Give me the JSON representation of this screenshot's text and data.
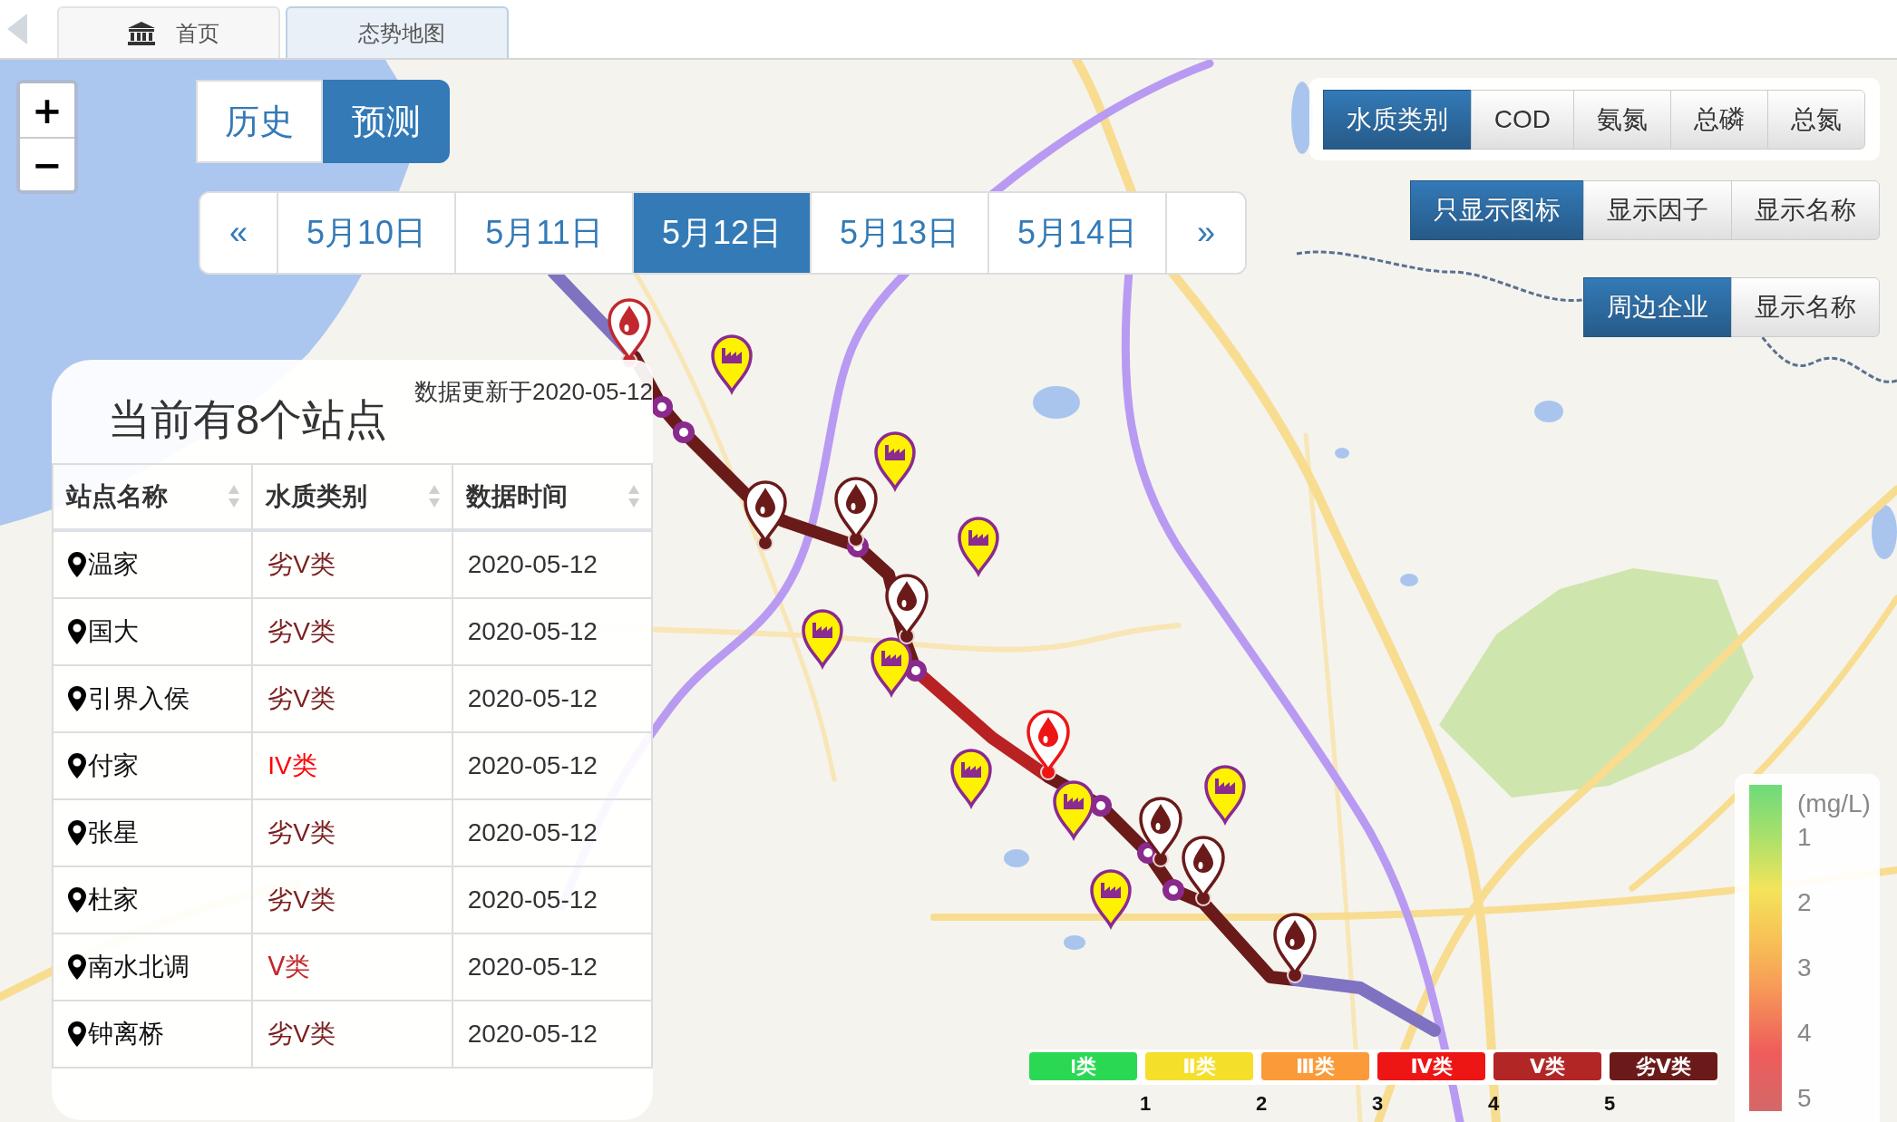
{
  "tabs": [
    {
      "kind": "home",
      "label": "首页",
      "selected": false
    },
    {
      "kind": "page",
      "label": "态势地图",
      "selected": true
    }
  ],
  "zoom": {
    "zoom_in": "+",
    "zoom_out": "−"
  },
  "mode_toggle": [
    {
      "label": "历史",
      "selected": false
    },
    {
      "label": "预测",
      "selected": true
    }
  ],
  "date_pager": {
    "prev": "«",
    "dates": [
      {
        "label": "5月10日",
        "selected": false
      },
      {
        "label": "5月11日",
        "selected": false
      },
      {
        "label": "5月12日",
        "selected": true
      },
      {
        "label": "5月13日",
        "selected": false
      },
      {
        "label": "5月14日",
        "selected": false
      }
    ],
    "next": "»"
  },
  "factor_buttons": [
    {
      "label": "水质类别",
      "selected": true
    },
    {
      "label": "COD",
      "selected": false
    },
    {
      "label": "氨氮",
      "selected": false
    },
    {
      "label": "总磷",
      "selected": false
    },
    {
      "label": "总氮",
      "selected": false
    }
  ],
  "display_buttons": [
    {
      "label": "只显示图标",
      "selected": true
    },
    {
      "label": "显示因子",
      "selected": false
    },
    {
      "label": "显示名称",
      "selected": false
    }
  ],
  "enterprise_buttons": [
    {
      "label": "周边企业",
      "selected": true
    },
    {
      "label": "显示名称",
      "selected": false
    }
  ],
  "map": {
    "route": [
      {
        "color": "#7f72c0"
      },
      {
        "color": "#6b1a1a"
      },
      {
        "color": "#b82222"
      },
      {
        "color": "#6b1a1a"
      },
      {
        "color": "#7f72c0"
      }
    ],
    "station_markers": [
      {
        "color": "#c0282d"
      },
      {
        "color": "#6b1a1a"
      },
      {
        "color": "#6b1a1a"
      },
      {
        "color": "#6b1a1a"
      },
      {
        "color": "#ee1515"
      },
      {
        "color": "#6b1a1a"
      },
      {
        "color": "#6b1a1a"
      },
      {
        "color": "#6b1a1a"
      }
    ]
  },
  "station_panel": {
    "title": "当前有8个站点",
    "updated": "数据更新于2020-05-12",
    "columns": [
      "站点名称",
      "水质类别",
      "数据时间"
    ],
    "rows": [
      {
        "name": "温家",
        "class": "劣V类",
        "color": "#7a1f1f",
        "time": "2020-05-12"
      },
      {
        "name": "国大",
        "class": "劣V类",
        "color": "#7a1f1f",
        "time": "2020-05-12"
      },
      {
        "name": "引界入侯",
        "class": "劣V类",
        "color": "#7a1f1f",
        "time": "2020-05-12"
      },
      {
        "name": "付家",
        "class": "IV类",
        "color": "#ff0000",
        "time": "2020-05-12"
      },
      {
        "name": "张星",
        "class": "劣V类",
        "color": "#7a1f1f",
        "time": "2020-05-12"
      },
      {
        "name": "杜家",
        "class": "劣V类",
        "color": "#7a1f1f",
        "time": "2020-05-12"
      },
      {
        "name": "南水北调",
        "class": "Ⅴ类",
        "color": "#c0282d",
        "time": "2020-05-12"
      },
      {
        "name": "钟离桥",
        "class": "劣V类",
        "color": "#7a1f1f",
        "time": "2020-05-12"
      }
    ]
  },
  "class_legend": {
    "items": [
      {
        "label": "I类",
        "color": "#2bd854"
      },
      {
        "label": "Ⅱ类",
        "color": "#f4e02a"
      },
      {
        "label": "Ⅲ类",
        "color": "#fb9a38"
      },
      {
        "label": "Ⅳ类",
        "color": "#ee1515"
      },
      {
        "label": "Ⅴ类",
        "color": "#b22626"
      },
      {
        "label": "劣Ⅴ类",
        "color": "#6b1a1a"
      }
    ],
    "ticks": [
      "1",
      "2",
      "3",
      "4",
      "5"
    ]
  },
  "color_scale": {
    "unit": "(mg/L)",
    "ticks": [
      "1",
      "2",
      "3",
      "4",
      "5"
    ]
  }
}
